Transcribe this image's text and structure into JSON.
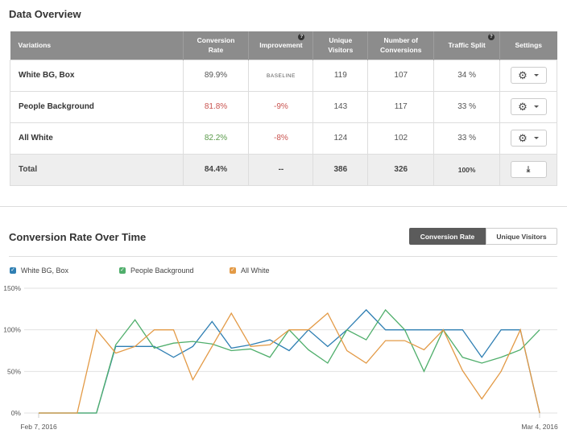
{
  "overview": {
    "title": "Data Overview",
    "columns": [
      "Variations",
      "Conversion Rate",
      "Improvement",
      "Unique Visitors",
      "Number of Conversions",
      "Traffic Split",
      "Settings"
    ],
    "column_lines": [
      [
        "Variations"
      ],
      [
        "Conversion",
        "Rate"
      ],
      [
        "Improvement"
      ],
      [
        "Unique",
        "Visitors"
      ],
      [
        "Number of",
        "Conversions"
      ],
      [
        "Traffic Split"
      ],
      [
        "Settings"
      ]
    ],
    "help_icon": "?",
    "rows": [
      {
        "name": "White BG, Box",
        "rate": "89.9%",
        "rate_color": "neutral",
        "improvement": "BASELINE",
        "visitors": "119",
        "conversions": "107",
        "split": "34 %"
      },
      {
        "name": "People Background",
        "rate": "81.8%",
        "rate_color": "red",
        "improvement": "-9%",
        "visitors": "143",
        "conversions": "117",
        "split": "33 %"
      },
      {
        "name": "All White",
        "rate": "82.2%",
        "rate_color": "green",
        "improvement": "-8%",
        "visitors": "124",
        "conversions": "102",
        "split": "33 %"
      }
    ],
    "total": {
      "name": "Total",
      "rate": "84.4%",
      "improvement": "--",
      "visitors": "386",
      "conversions": "326",
      "split": "100%"
    }
  },
  "chart_section": {
    "title": "Conversion Rate Over Time",
    "toggle": {
      "active": "Conversion Rate",
      "inactive": "Unique Visitors"
    }
  },
  "colors": {
    "blue": "#2f7fb3",
    "green": "#4fae6b",
    "orange": "#e39a46",
    "header": "#8c8c8c"
  },
  "chart_data": {
    "type": "line",
    "title": "Conversion Rate Over Time",
    "xlabel": "",
    "ylabel": "",
    "ylim": [
      0,
      150
    ],
    "yticks": [
      "0%",
      "50%",
      "100%",
      "150%"
    ],
    "ytick_values": [
      0,
      50,
      100,
      150
    ],
    "x_start_label": "Feb 7, 2016",
    "x_end_label": "Mar 4, 2016",
    "grid": true,
    "legend_position": "top-left",
    "x": [
      "Feb 7",
      "Feb 8",
      "Feb 9",
      "Feb 10",
      "Feb 11",
      "Feb 12",
      "Feb 13",
      "Feb 14",
      "Feb 15",
      "Feb 16",
      "Feb 17",
      "Feb 18",
      "Feb 19",
      "Feb 20",
      "Feb 21",
      "Feb 22",
      "Feb 23",
      "Feb 24",
      "Feb 25",
      "Feb 26",
      "Feb 27",
      "Feb 28",
      "Feb 29",
      "Mar 1",
      "Mar 2",
      "Mar 3",
      "Mar 4"
    ],
    "series": [
      {
        "name": "White BG, Box",
        "color": "#2f7fb3",
        "values": [
          0,
          0,
          0,
          0,
          80,
          80,
          80,
          67,
          80,
          110,
          78,
          82,
          88,
          75,
          100,
          80,
          100,
          124,
          100,
          100,
          100,
          100,
          100,
          67,
          100,
          100,
          0
        ]
      },
      {
        "name": "People Background",
        "color": "#4fae6b",
        "values": [
          0,
          0,
          0,
          0,
          82,
          112,
          78,
          84,
          86,
          83,
          75,
          77,
          67,
          100,
          76,
          60,
          100,
          88,
          124,
          100,
          50,
          100,
          67,
          60,
          67,
          76,
          100
        ]
      },
      {
        "name": "All White",
        "color": "#e39a46",
        "values": [
          0,
          0,
          0,
          100,
          72,
          80,
          100,
          100,
          40,
          80,
          120,
          80,
          82,
          100,
          100,
          120,
          75,
          60,
          87,
          87,
          76,
          100,
          51,
          17,
          50,
          100,
          0
        ]
      }
    ]
  }
}
